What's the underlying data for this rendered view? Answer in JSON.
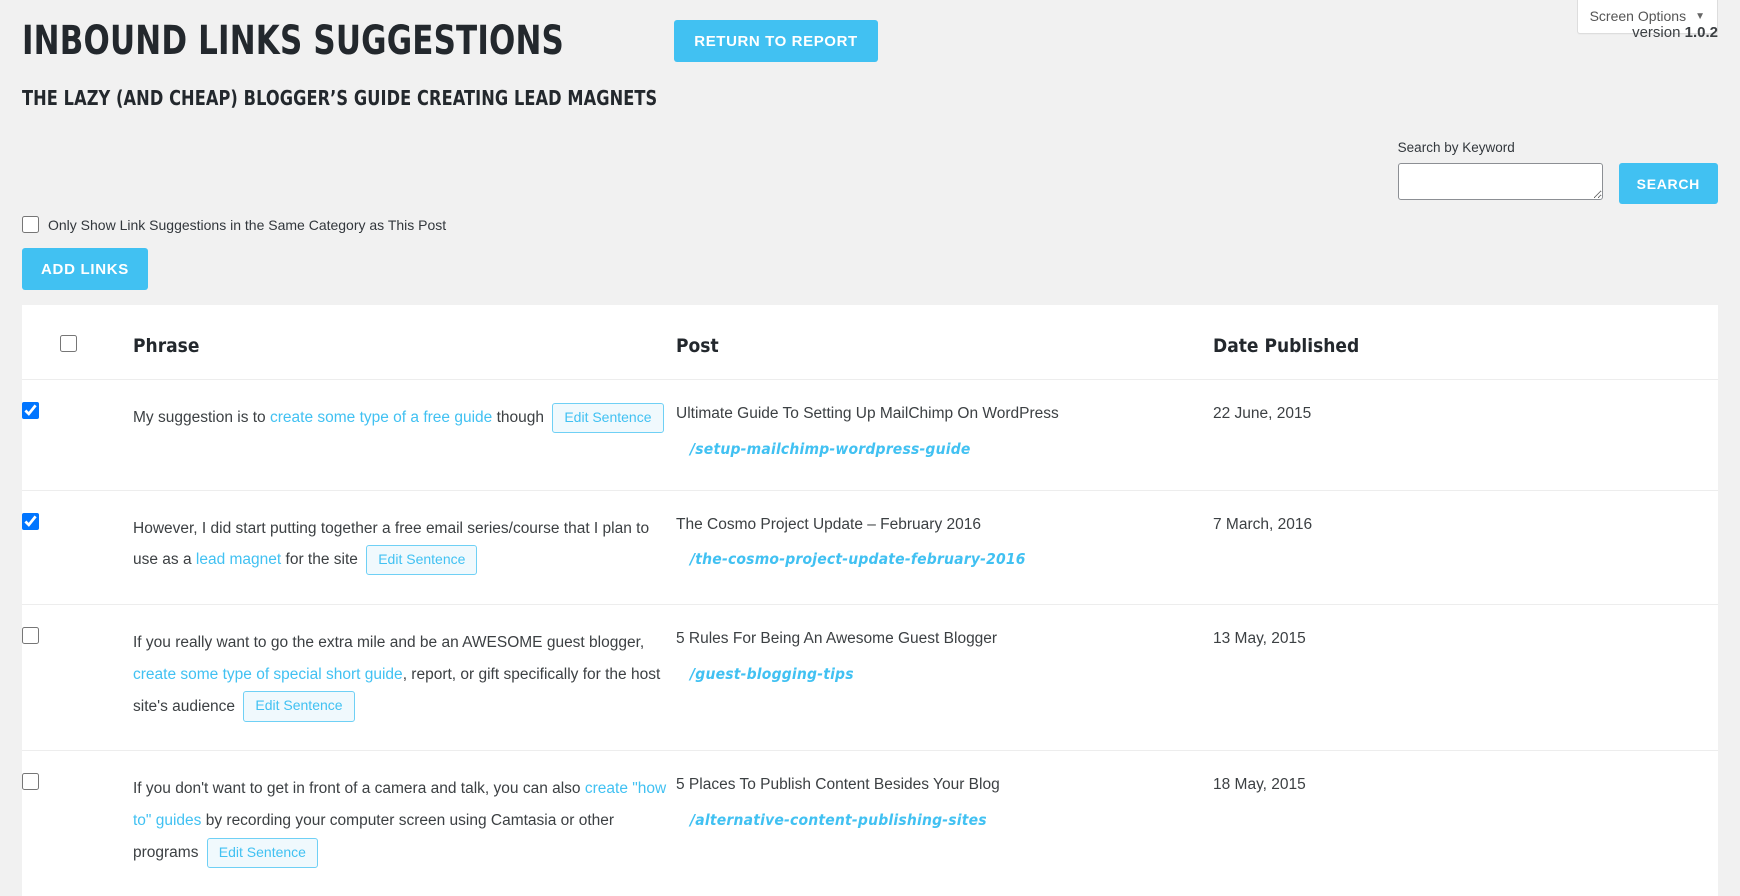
{
  "header": {
    "title": "Inbound Links Suggestions",
    "return_button": "Return to Report",
    "subtitle": "The Lazy (and Cheap) Blogger’s Guide Creating Lead Magnets",
    "version_label": "version",
    "version_number": "1.0.2",
    "screen_options": "Screen Options",
    "screen_options_caret": "▼"
  },
  "search": {
    "label": "Search by Keyword",
    "value": "",
    "placeholder": "",
    "button": "Search"
  },
  "filters": {
    "same_category_label": "Only Show Link Suggestions in the Same Category as This Post",
    "same_category_checked": false,
    "add_links_button": "Add Links"
  },
  "table": {
    "columns": [
      "",
      "Phrase",
      "Post",
      "Date Published"
    ],
    "select_all_checked": false,
    "edit_button_label": "Edit Sentence",
    "rows": [
      {
        "checked": true,
        "phrase_before": "My suggestion is to ",
        "phrase_link": "create some type of a free guide",
        "phrase_after": " though",
        "post_title": "Ultimate Guide To Setting Up MailChimp On WordPress",
        "post_slug": "/setup-mailchimp-wordpress-guide",
        "date": "22 June, 2015"
      },
      {
        "checked": true,
        "phrase_before": "However, I did start putting together a free email series/course that I plan to use as a ",
        "phrase_link": "lead magnet",
        "phrase_after": " for the site",
        "post_title": "The Cosmo Project Update – February 2016",
        "post_slug": "/the-cosmo-project-update-february-2016",
        "date": "7 March, 2016"
      },
      {
        "checked": false,
        "phrase_before": "If you really want to go the extra mile and be an AWESOME guest blogger, ",
        "phrase_link": "create some type of special short guide",
        "phrase_after": ", report, or gift specifically for the host site's audience",
        "post_title": "5 Rules For Being An Awesome Guest Blogger",
        "post_slug": "/guest-blogging-tips",
        "date": "13 May, 2015"
      },
      {
        "checked": false,
        "phrase_before": "If you don't want to get in front of a camera and talk, you can also ",
        "phrase_link": "create \"how to\" guides",
        "phrase_after": " by recording your computer screen using Camtasia or other programs",
        "post_title": "5 Places To Publish Content Besides Your Blog",
        "post_slug": "/alternative-content-publishing-sites",
        "date": "18 May, 2015"
      }
    ]
  },
  "colors": {
    "accent": "#41c1f2",
    "page_bg": "#f1f1f1",
    "text": "#3c4043"
  }
}
